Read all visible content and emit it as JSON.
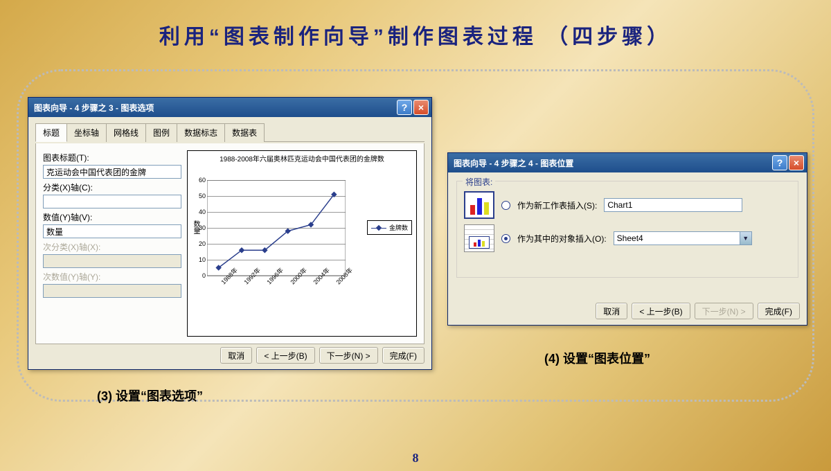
{
  "slide": {
    "title": "利用“图表制作向导”制作图表过程 （四步骤）",
    "page_number": "8",
    "caption3": "(3) 设置“图表选项”",
    "caption4": "(4) 设置“图表位置”"
  },
  "dialog3": {
    "title": "图表向导 - 4 步骤之 3 - 图表选项",
    "help": "?",
    "close": "×",
    "tabs": [
      "标题",
      "坐标轴",
      "网格线",
      "图例",
      "数据标志",
      "数据表"
    ],
    "labels": {
      "chart_title": "图表标题(T):",
      "x_axis": "分类(X)轴(C):",
      "y_axis": "数值(Y)轴(V):",
      "x2_axis": "次分类(X)轴(X):",
      "y2_axis": "次数值(Y)轴(Y):"
    },
    "values": {
      "chart_title": "克运动会中国代表团的金牌",
      "x_axis": "",
      "y_axis": "数量",
      "x2_axis": "",
      "y2_axis": ""
    },
    "buttons": {
      "cancel": "取消",
      "back": "< 上一步(B)",
      "next": "下一步(N) >",
      "finish": "完成(F)"
    }
  },
  "dialog4": {
    "title": "图表向导 - 4 步骤之 4 - 图表位置",
    "help": "?",
    "close": "×",
    "group_title": "将图表:",
    "options": {
      "new_sheet_label": "作为新工作表插入(S):",
      "new_sheet_value": "Chart1",
      "object_label": "作为其中的对象插入(O):",
      "object_value": "Sheet4"
    },
    "buttons": {
      "cancel": "取消",
      "back": "< 上一步(B)",
      "next": "下一步(N) >",
      "finish": "完成(F)"
    }
  },
  "chart_data": {
    "type": "line",
    "title": "1988-2008年六届奥林匹克运动会中国代表团的金牌数",
    "xlabel": "",
    "ylabel": "数量",
    "ylim": [
      0,
      60
    ],
    "yticks": [
      0,
      10,
      20,
      30,
      40,
      50,
      60
    ],
    "categories": [
      "1988年",
      "1992年",
      "1996年",
      "2000年",
      "2004年",
      "2008年"
    ],
    "series": [
      {
        "name": "金牌数",
        "values": [
          5,
          16,
          16,
          28,
          32,
          51
        ]
      }
    ]
  }
}
